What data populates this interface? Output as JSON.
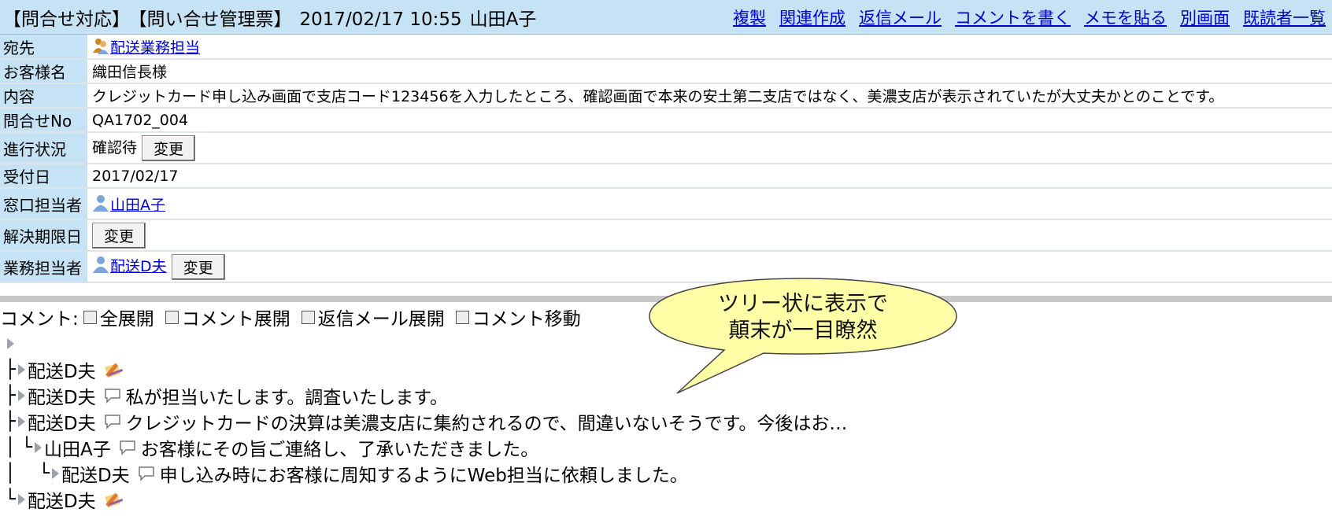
{
  "header": {
    "category": "【問合せ対応】",
    "form": "【問い合せ管理票】",
    "datetime": "2017/02/17 10:55",
    "author": "山田A子",
    "links": [
      "複製",
      "関連作成",
      "返信メール",
      "コメントを書く",
      "メモを貼る",
      "別画面",
      "既読者一覧"
    ]
  },
  "fields": {
    "to": {
      "label": "宛先",
      "value": "配送業務担当"
    },
    "customer": {
      "label": "お客様名",
      "value": "織田信長様"
    },
    "content": {
      "label": "内容",
      "value": "クレジットカード申し込み画面で支店コード123456を入力したところ、確認画面で本来の安土第二支店ではなく、美濃支店が表示されていたが大丈夫かとのことです。"
    },
    "inquiry_no": {
      "label": "問合せNo",
      "value": "QA1702_004"
    },
    "status": {
      "label": "進行状況",
      "value": "確認待"
    },
    "received": {
      "label": "受付日",
      "value": "2017/02/17"
    },
    "contact": {
      "label": "窓口担当者",
      "value": "山田A子"
    },
    "deadline": {
      "label": "解決期限日",
      "value": ""
    },
    "staff": {
      "label": "業務担当者",
      "value": "配送D夫"
    },
    "change_label": "変更"
  },
  "comment_options": {
    "label": "コメント:",
    "checks": [
      "全展開",
      "コメント展開",
      "返信メール展開",
      "コメント移動"
    ]
  },
  "tree": [
    {
      "prefix": "├",
      "name": "配送D夫",
      "icon": "memo-icon",
      "text": ""
    },
    {
      "prefix": "├",
      "name": "配送D夫",
      "icon": "speech-bubble-icon",
      "text": "私が担当いたします。調査いたします。"
    },
    {
      "prefix": "├",
      "name": "配送D夫",
      "icon": "speech-bubble-icon",
      "text": "クレジットカードの決算は美濃支店に集約されるので、間違いないそうです。今後はお…"
    },
    {
      "prefix": "│ └",
      "name": "山田A子",
      "icon": "speech-bubble-icon",
      "text": "お客様にその旨ご連絡し、了承いただきました。"
    },
    {
      "prefix": "│    └",
      "name": "配送D夫",
      "icon": "speech-bubble-icon",
      "text": "申し込み時にお客様に周知するようにWeb担当に依頼しました。"
    },
    {
      "prefix": "└",
      "name": "配送D夫",
      "icon": "memo-icon",
      "text": ""
    }
  ],
  "callout": {
    "line1": "ツリー状に表示で",
    "line2": "顛末が一目瞭然"
  }
}
